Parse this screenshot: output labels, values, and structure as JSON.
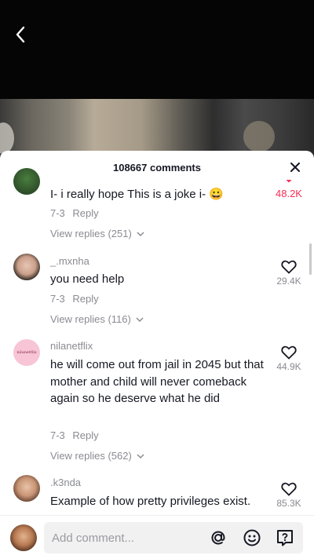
{
  "header": {
    "comments_count_label": "108667 comments"
  },
  "comments": [
    {
      "username": "",
      "text": "I- i really hope This is a joke i- 😀",
      "date": "7-3",
      "reply_label": "Reply",
      "view_replies": "View replies (251)",
      "likes": "48.2K",
      "liked": true
    },
    {
      "username": "_.mxnha",
      "text": "you need help",
      "date": "7-3",
      "reply_label": "Reply",
      "view_replies": "View replies (116)",
      "likes": "29.4K",
      "liked": false
    },
    {
      "username": "nilanetflix",
      "avatar_text": "nilanetflix",
      "text": "he will come out from jail in 2045 but that mother and child will never comeback again so he deserve what he did",
      "date": "7-3",
      "reply_label": "Reply",
      "view_replies": "View replies (562)",
      "likes": "44.9K",
      "liked": false
    },
    {
      "username": ".k3nda",
      "text": "Example of how pretty privileges exist.",
      "likes": "85.3K",
      "liked": false
    }
  ],
  "input": {
    "placeholder": "Add comment..."
  },
  "icons": {
    "back": "chevron-left-icon",
    "close": "close-icon",
    "heart": "heart-outline-icon",
    "mention": "at-sign-icon",
    "emoji": "smile-emoji-icon",
    "question": "question-bubble-icon"
  },
  "colors": {
    "like_active": "#fe2c55",
    "text": "#161823",
    "secondary": "#8a8b91"
  }
}
